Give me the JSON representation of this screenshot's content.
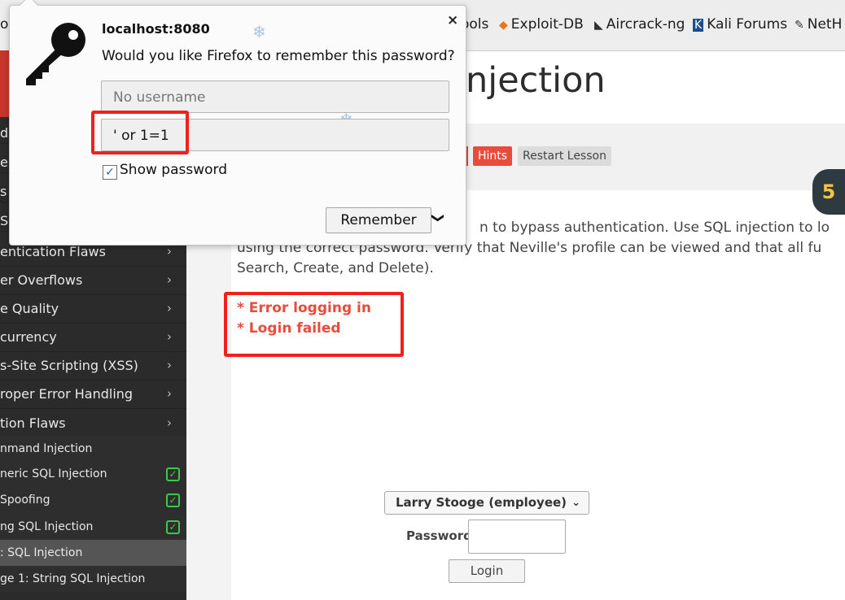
{
  "bookmarks": [
    {
      "label": "ols",
      "icon": "bookmark-fragment"
    },
    {
      "label": "ools",
      "icon": "tools-fragment"
    },
    {
      "label": "Exploit-DB",
      "icon": "exploit-db-icon"
    },
    {
      "label": "Aircrack-ng",
      "icon": "aircrack-icon"
    },
    {
      "label": "Kali Forums",
      "icon": "kali-forums-icon"
    },
    {
      "label": "NetH",
      "icon": "nethunter-icon"
    }
  ],
  "sidebar": {
    "rows_top": [
      "d",
      "er",
      "s",
      "S"
    ],
    "categories": [
      "entication Flaws",
      "er Overflows",
      "e Quality",
      "currency",
      "s-Site Scripting (XSS)",
      "roper Error Handling",
      "tion Flaws"
    ],
    "sub_items": [
      {
        "label": "nmand Injection",
        "checked": false
      },
      {
        "label": "neric SQL Injection",
        "checked": true
      },
      {
        "label": " Spoofing",
        "checked": true
      },
      {
        "label": "ng SQL Injection",
        "checked": true
      },
      {
        "label": ": SQL Injection",
        "checked": false,
        "active": true
      },
      {
        "label": "ge 1: String SQL Injection",
        "checked": false
      }
    ]
  },
  "page": {
    "title": "njection",
    "hints_label": "Hints",
    "restart_label": "Restart Lesson",
    "lesson_lines": [
      "n to bypass authentication. Use SQL injection to lo",
      "using the correct password. Verify that Neville's profile can be viewed and that all fu",
      "Search, Create, and Delete)."
    ],
    "errors": [
      "* Error logging in",
      "* Login failed"
    ],
    "badge": "5"
  },
  "login_form": {
    "employee_selected": "Larry Stooge (employee)",
    "password_label": "Password",
    "password_value": "",
    "login_button": "Login"
  },
  "password_popup": {
    "host": "localhost:8080",
    "question": "Would you like Firefox to remember this password?",
    "username_placeholder": "No username",
    "password_value": "' or 1=1",
    "show_password_label": "Show password",
    "show_password_checked": true,
    "remember_label": "Remember",
    "close_glyph": "×"
  },
  "colors": {
    "highlight_box": "#f0201a",
    "error_text": "#e74c3c",
    "sidebar_bg": "#2b2b2b",
    "check_green": "#3ec84b"
  }
}
